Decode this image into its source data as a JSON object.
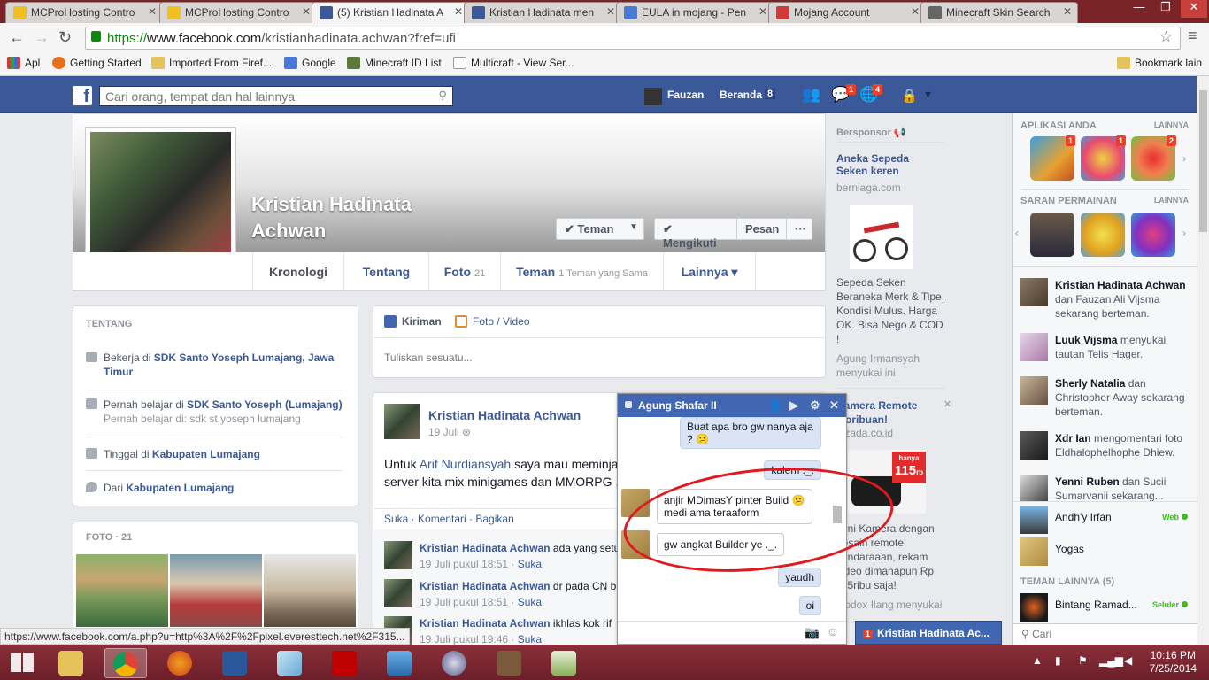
{
  "browser": {
    "tabs": [
      {
        "title": "MCProHosting Contro",
        "favicon_color": "#f0c020"
      },
      {
        "title": "MCProHosting Contro",
        "favicon_color": "#f0c020"
      },
      {
        "title": "(5) Kristian Hadinata A",
        "favicon_color": "#3b5998"
      },
      {
        "title": "Kristian Hadinata men",
        "favicon_color": "#3b5998"
      },
      {
        "title": "EULA in mojang - Pen",
        "favicon_color": "#4a7ad8"
      },
      {
        "title": "Mojang Account",
        "favicon_color": "#d23a3a"
      },
      {
        "title": "Minecraft Skin Search",
        "favicon_color": "#666666"
      }
    ],
    "url_scheme": "https://",
    "url_host": "www.facebook.com",
    "url_path": "/kristianhadinata.achwan?fref=ufi",
    "bookmarks": [
      {
        "label": "Apl",
        "icon": "apps-icon"
      },
      {
        "label": "Getting Started",
        "icon": "firefox-icon"
      },
      {
        "label": "Imported From Firef...",
        "icon": "folder-icon"
      },
      {
        "label": "Google",
        "icon": "google-icon"
      },
      {
        "label": "Minecraft ID List",
        "icon": "minecraft-icon"
      },
      {
        "label": "Multicraft - View Ser...",
        "icon": "page-icon"
      }
    ],
    "other_bookmarks": "Bookmark lain",
    "status_url": "https://www.facebook.com/a.php?u=http%3A%2F%2Fpixel.everesttech.net%2F315..."
  },
  "fb_header": {
    "search_placeholder": "Cari orang, tempat dan hal lainnya",
    "user_name": "Fauzan",
    "home_label": "Beranda",
    "home_count": "8",
    "messages_badge": "1",
    "notifications_badge": "4"
  },
  "profile": {
    "name_line1": "Kristian Hadinata",
    "name_line2": "Achwan",
    "buttons": {
      "friend": "✔ Teman",
      "following": "✔ Mengikuti",
      "message": "Pesan",
      "more": "···"
    },
    "tabs": [
      {
        "label": "Kronologi",
        "count": ""
      },
      {
        "label": "Tentang",
        "count": ""
      },
      {
        "label": "Foto",
        "count": "21"
      },
      {
        "label": "Teman",
        "count": "1 Teman yang Sama"
      },
      {
        "label": "Lainnya ▾",
        "count": ""
      }
    ]
  },
  "about": {
    "heading": "TENTANG",
    "work_prefix": "Bekerja di ",
    "work_place": "SDK Santo Yoseph Lumajang, Jawa Timur",
    "study_prefix": "Pernah belajar di ",
    "study_place": "SDK Santo Yoseph (Lumajang)",
    "study_sub": "Pernah belajar di: sdk st.yoseph lumajang",
    "lives_prefix": "Tinggal di ",
    "lives_place": "Kabupaten Lumajang",
    "from_prefix": "Dari ",
    "from_place": "Kabupaten Lumajang"
  },
  "photos": {
    "heading": "FOTO · 21"
  },
  "composer": {
    "tab_post": "Kiriman",
    "tab_photo": "Foto / Video",
    "placeholder": "Tuliskan sesuatu..."
  },
  "post": {
    "author": "Kristian Hadinata Achwan",
    "date": "19 Juli",
    "text_prefix": "Untuk ",
    "text_link": "Arif Nurdiansyah",
    "text_rest": " saya mau meminja",
    "text_line2": "server kita mix minigames dan MMORPG ,",
    "actions": "Suka · Komentari · Bagikan",
    "comments": [
      {
        "author": "Kristian Hadinata Achwan",
        "text": " ada yang setu",
        "time": "19 Juli pukul 18:51",
        "like": "Suka"
      },
      {
        "author": "Kristian Hadinata Achwan",
        "text": " dr pada CN b",
        "time": "19 Juli pukul 18:51",
        "like": "Suka"
      },
      {
        "author": "Kristian Hadinata Achwan",
        "text": " ikhlas kok rif",
        "time": "19 Juli pukul 19:46",
        "like": "Suka"
      }
    ]
  },
  "chat": {
    "name": "Agung Shafar II",
    "messages": [
      {
        "from": "me",
        "text": "Buat apa bro gw nanya aja ? 😕"
      },
      {
        "from": "me",
        "text": "kalem ._."
      },
      {
        "from": "them",
        "text": "anjir MDimasY pinter Build 😕 medi ama teraaform"
      },
      {
        "from": "them",
        "text": "gw angkat Builder ye ._."
      },
      {
        "from": "me",
        "text": "yaudh"
      },
      {
        "from": "me",
        "text": "oi"
      }
    ]
  },
  "ads": {
    "heading": "Bersponsor",
    "ad1_title": "Aneka Sepeda Seken keren",
    "ad1_site": "berniaga.com",
    "ad1_text": "Sepeda Seken Beraneka Merk & Tipe. Kondisi Mulus. Harga OK. Bisa Nego & COD !",
    "ad1_social": "Agung Irmansyah menyukai ini",
    "ad2_title": "Kamera Remote Moribuan!",
    "ad2_site": "lazada.co.id",
    "ad2_price_top": "hanya",
    "ad2_price": "115",
    "ad2_price_unit": "rb",
    "ad2_text": "Mini Kamera dengan desain remote kendaraaan, rekam video dimanapun Rp 115ribu saja!",
    "ad2_social": "Godox Ilang menyukai"
  },
  "chat_tab": {
    "badge": "1",
    "name": "Kristian Hadinata Ac..."
  },
  "sidebar": {
    "apps_heading": "APLIKASI ANDA",
    "apps_more": "LAINNYA",
    "app_badges": [
      "1",
      "1",
      "2"
    ],
    "games_heading": "SARAN PERMAINAN",
    "games_more": "LAINNYA",
    "ticker": [
      {
        "name": "Kristian Hadinata Achwan",
        "text": " dan Fauzan Ali Vijsma sekarang berteman."
      },
      {
        "name": "Luuk Vijsma",
        "text": " menyukai tautan Telis Hager."
      },
      {
        "name": "Sherly Natalia",
        "text": " dan Christopher Away sekarang berteman."
      },
      {
        "name": "Xdr Ian",
        "text": " mengomentari foto Eldhalophelhophe Dhiew."
      },
      {
        "name": "Yenni Ruben",
        "text": " dan Sucii Sumarvanii sekarang..."
      }
    ],
    "contacts": [
      {
        "name": "Andh'y Irfan",
        "status": "Web"
      },
      {
        "name": "Yogas",
        "status": ""
      }
    ],
    "other_heading": "TEMAN LAINNYA (5)",
    "other_contacts": [
      {
        "name": "Bintang Ramad...",
        "status": "Seluler"
      }
    ],
    "search_placeholder": "Cari"
  },
  "taskbar": {
    "time": "10:16 PM",
    "date": "7/25/2014"
  }
}
